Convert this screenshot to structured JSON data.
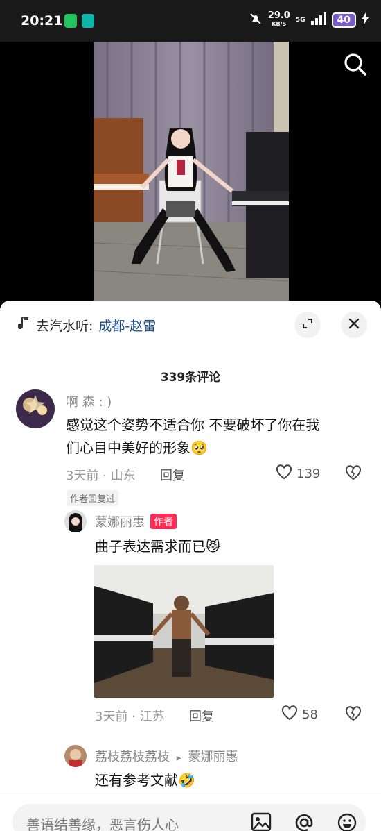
{
  "status_bar": {
    "time": "20:21",
    "net_speed": "29.0",
    "net_unit": "KB/S",
    "signal": "5G",
    "battery": "40"
  },
  "music_bar": {
    "prefix": "去汽水听:",
    "song": "成都-赵雷"
  },
  "comments": {
    "count_label": "339条评论",
    "items": [
      {
        "user": "啊 森 : )",
        "text_line1": "感觉这个姿势不适合你 不要破坏了你在我",
        "text_line2": "们心目中美好的形象",
        "emoji": "🥺",
        "meta": "3天前 · 山东",
        "reply_label": "回复",
        "likes": "139",
        "author_replied_tag": "作者回复过"
      }
    ],
    "replies": [
      {
        "user": "蒙娜丽惠",
        "author_tag": "作者",
        "text": "曲子表达需求而已",
        "emoji": "😼",
        "meta": "3天前 · 江苏",
        "reply_label": "回复",
        "likes": "58"
      },
      {
        "user": "荔枝荔枝荔枝",
        "arrow": "▸",
        "reply_to": "蒙娜丽惠",
        "text": "还有参考文献",
        "emoji": "🤣"
      }
    ]
  },
  "input": {
    "placeholder": "善语结善缘，恶言伤人心"
  },
  "icons": {
    "search": "search-icon",
    "expand": "expand-icon",
    "close": "close-icon",
    "heart": "heart-icon",
    "dislike": "broken-heart-icon",
    "image": "image-icon",
    "mention": "at-icon",
    "emoji": "emoji-icon"
  },
  "colors": {
    "accent": "#fe2c55",
    "link": "#1b4f8c"
  }
}
